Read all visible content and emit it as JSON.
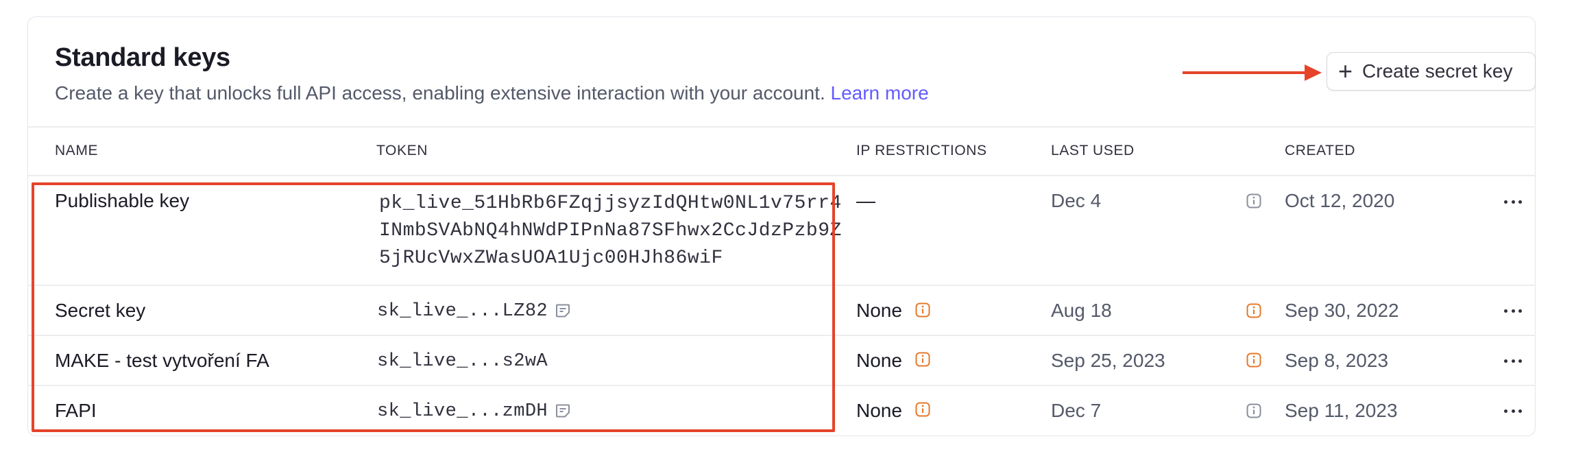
{
  "header": {
    "title": "Standard keys",
    "subtitle": "Create a key that unlocks full API access, enabling extensive interaction with your account.",
    "learn_more": "Learn more",
    "create_button_label": "Create secret key"
  },
  "columns": {
    "name": "NAME",
    "token": "TOKEN",
    "ip_restrictions": "IP RESTRICTIONS",
    "last_used": "LAST USED",
    "created": "CREATED"
  },
  "rows": [
    {
      "name": "Publishable key",
      "token_lines": [
        "pk_live_51HbRb6FZqjjsyzIdQHtw0NL1v75rr4",
        "INmbSVAbNQ4hNWdPIPnNa87SFhwx2CcJdzPzb9Z",
        "5jRUcVwxZWasUOA1Ujc00HJh86wiF"
      ],
      "ip_restrictions": "—",
      "last_used": "Dec 4",
      "created": "Oct 12, 2020"
    },
    {
      "name": "Secret key",
      "token": "sk_live_...LZ82",
      "ip_restrictions": "None",
      "last_used": "Aug 18",
      "created": "Sep 30, 2022"
    },
    {
      "name": "MAKE - test vytvoření FA",
      "token": "sk_live_...s2wA",
      "ip_restrictions": "None",
      "last_used": "Sep 25, 2023",
      "created": "Sep 8, 2023"
    },
    {
      "name": "FAPI",
      "token": "sk_live_...zmDH",
      "ip_restrictions": "None",
      "last_used": "Dec 7",
      "created": "Sep 11, 2023"
    }
  ],
  "colors": {
    "accent_link": "#635bff",
    "warning_orange": "#e5782a",
    "annotation_red": "#e5432a"
  }
}
